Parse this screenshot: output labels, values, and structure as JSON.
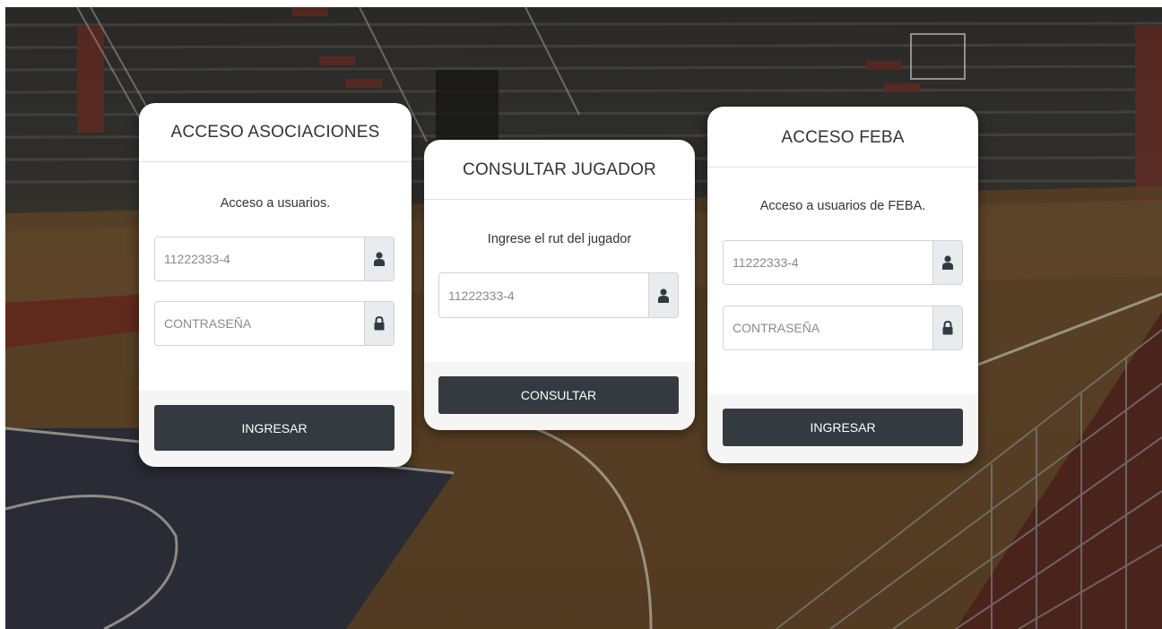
{
  "cards": {
    "asociaciones": {
      "title": "ACCESO ASOCIACIONES",
      "description": "Acceso a usuarios.",
      "user_placeholder": "11222333-4",
      "password_placeholder": "CONTRASEÑA",
      "button_label": "INGRESAR",
      "user_icon": "user-icon",
      "lock_icon": "lock-icon"
    },
    "consultar": {
      "title": "CONSULTAR JUGADOR",
      "description": "Ingrese el rut del jugador",
      "rut_placeholder": "11222333-4",
      "button_label": "CONSULTAR",
      "user_icon": "user-icon"
    },
    "feba": {
      "title": "ACCESO FEBA",
      "description": "Acceso a usuarios de FEBA.",
      "user_placeholder": "11222333-4",
      "password_placeholder": "CONTRASEÑA",
      "button_label": "INGRESAR",
      "user_icon": "user-icon",
      "lock_icon": "lock-icon"
    }
  },
  "colors": {
    "button_bg": "#343a40",
    "addon_bg": "#e9ecef",
    "card_bg": "#ffffff"
  }
}
